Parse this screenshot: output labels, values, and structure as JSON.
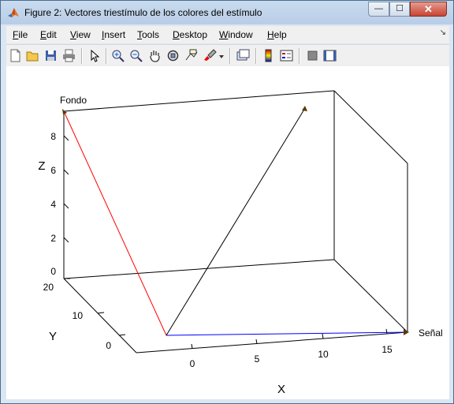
{
  "window": {
    "title": "Figure 2: Vectores triestímulo de los colores del estímulo",
    "controls": {
      "minimize": "—",
      "maximize": "☐",
      "close": "✕"
    }
  },
  "menubar": {
    "items": [
      {
        "label": "File",
        "mnemonic": "F"
      },
      {
        "label": "Edit",
        "mnemonic": "E"
      },
      {
        "label": "View",
        "mnemonic": "V"
      },
      {
        "label": "Insert",
        "mnemonic": "I"
      },
      {
        "label": "Tools",
        "mnemonic": "T"
      },
      {
        "label": "Desktop",
        "mnemonic": "D"
      },
      {
        "label": "Window",
        "mnemonic": "W"
      },
      {
        "label": "Help",
        "mnemonic": "H"
      }
    ]
  },
  "toolbar": {
    "icons": [
      "new-figure-icon",
      "open-file-icon",
      "save-icon",
      "print-icon",
      "edit-plot-arrow-icon",
      "zoom-in-icon",
      "zoom-out-icon",
      "pan-hand-icon",
      "rotate-3d-icon",
      "data-cursor-icon",
      "brush-icon",
      "brush-dropdown-icon",
      "link-plot-icon",
      "colorbar-icon",
      "legend-icon",
      "hide-plot-tools-icon",
      "show-plot-tools-icon"
    ]
  },
  "plot": {
    "xlabel": "X",
    "ylabel": "Y",
    "zlabel": "Z",
    "x_ticks": [
      "0",
      "5",
      "10",
      "15"
    ],
    "y_ticks": [
      "0",
      "10",
      "20"
    ],
    "z_ticks": [
      "0",
      "2",
      "4",
      "6",
      "8"
    ],
    "labels": {
      "fondo": "Fondo",
      "senal": "Señal"
    },
    "colors": {
      "fondo_vector": "#ff0000",
      "senal_vector": "#0000ff",
      "third_vector": "#000000",
      "marker": "#5a3a0a"
    }
  }
}
